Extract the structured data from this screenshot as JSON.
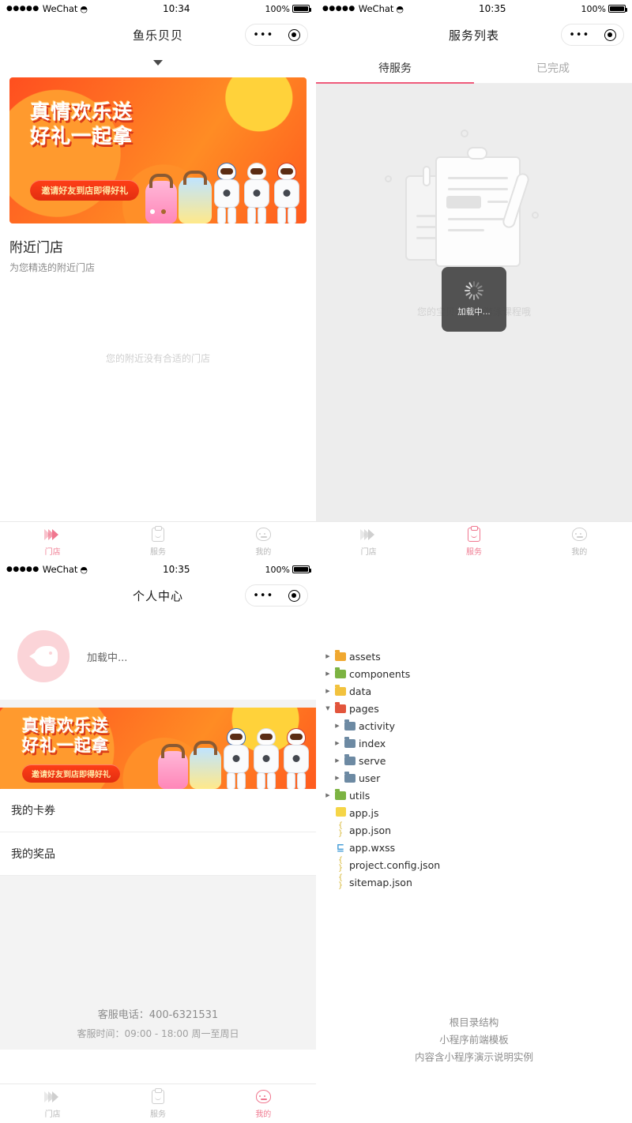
{
  "status_bar": {
    "carrier": "WeChat",
    "signal_dots": "●●●●●",
    "wifi_icon": "wifi-icon",
    "battery_percent": "100%",
    "time_panel1": "10:34",
    "time_panel2": "10:35",
    "time_panel3": "10:35"
  },
  "capsule": {
    "more_icon": "•••",
    "target_icon": "target-icon"
  },
  "panel1": {
    "title": "鱼乐贝贝",
    "dropdown_icon": "chevron-down-icon",
    "banner": {
      "line1": "真情欢乐送",
      "line2": "好礼一起拿",
      "button": "邀请好友到店即得好礼",
      "dots": 2,
      "active_dot": 1
    },
    "section_title": "附近门店",
    "section_sub": "为您精选的附近门店",
    "empty_text": "您的附近没有合适的门店",
    "tabbar": [
      {
        "label": "门店",
        "icon": "store-icon",
        "active": true
      },
      {
        "label": "服务",
        "icon": "clipboard-icon",
        "active": false
      },
      {
        "label": "我的",
        "icon": "face-icon",
        "active": false
      }
    ]
  },
  "panel2": {
    "title": "服务列表",
    "tabs": [
      {
        "label": "待服务",
        "active": true
      },
      {
        "label": "已完成",
        "active": false
      }
    ],
    "empty_text": "您的宝贝还没有游泳课程哦",
    "toast_text": "加载中...",
    "illustration": "empty-clipboard-illustration",
    "tabbar": [
      {
        "label": "门店",
        "icon": "store-icon",
        "active": false
      },
      {
        "label": "服务",
        "icon": "clipboard-icon",
        "active": true
      },
      {
        "label": "我的",
        "icon": "face-icon",
        "active": false
      }
    ]
  },
  "panel3": {
    "title": "个人中心",
    "avatar_icon": "fish-avatar-icon",
    "loading_text": "加载中...",
    "banner": {
      "line1": "真情欢乐送",
      "line2": "好礼一起拿",
      "button": "邀请好友到店即得好礼"
    },
    "menu": [
      {
        "label": "我的卡券"
      },
      {
        "label": "我的奖品"
      }
    ],
    "contact_phone": "客服电话：400-6321531",
    "contact_hours": "客服时间：09:00 - 18:00 周一至周日",
    "tabbar": [
      {
        "label": "门店",
        "icon": "store-icon",
        "active": false
      },
      {
        "label": "服务",
        "icon": "clipboard-icon",
        "active": false
      },
      {
        "label": "我的",
        "icon": "face-icon",
        "active": true
      }
    ]
  },
  "panel4": {
    "tree": [
      {
        "label": "assets",
        "type": "folder",
        "color": "orange",
        "state": "collapsed",
        "depth": 0
      },
      {
        "label": "components",
        "type": "folder",
        "color": "green",
        "state": "collapsed",
        "depth": 0
      },
      {
        "label": "data",
        "type": "folder",
        "color": "yellow",
        "state": "collapsed",
        "depth": 0
      },
      {
        "label": "pages",
        "type": "folder",
        "color": "red",
        "state": "expanded",
        "depth": 0
      },
      {
        "label": "activity",
        "type": "folder",
        "color": "blue",
        "state": "collapsed",
        "depth": 1
      },
      {
        "label": "index",
        "type": "folder",
        "color": "blue",
        "state": "collapsed",
        "depth": 1
      },
      {
        "label": "serve",
        "type": "folder",
        "color": "blue",
        "state": "collapsed",
        "depth": 1
      },
      {
        "label": "user",
        "type": "folder",
        "color": "blue",
        "state": "collapsed",
        "depth": 1
      },
      {
        "label": "utils",
        "type": "folder",
        "color": "green",
        "state": "collapsed",
        "depth": 0
      },
      {
        "label": "app.js",
        "type": "js",
        "state": "leaf",
        "depth": 0
      },
      {
        "label": "app.json",
        "type": "json",
        "state": "leaf",
        "depth": 0,
        "glyph": "{ }"
      },
      {
        "label": "app.wxss",
        "type": "wxss",
        "state": "leaf",
        "depth": 0,
        "glyph": "⊑"
      },
      {
        "label": "project.config.json",
        "type": "json",
        "state": "leaf",
        "depth": 0,
        "glyph": "{ }"
      },
      {
        "label": "sitemap.json",
        "type": "json",
        "state": "leaf",
        "depth": 0,
        "glyph": "{ }"
      }
    ],
    "caption_line1": "根目录结构",
    "caption_line2": "小程序前端模板",
    "caption_line3": "内容含小程序演示说明实例"
  },
  "colors": {
    "accent_pink": "#f0778f",
    "tab_underline": "#ef5a7a",
    "banner_orange": "#ff6b22",
    "grey_bg": "#ededed"
  }
}
